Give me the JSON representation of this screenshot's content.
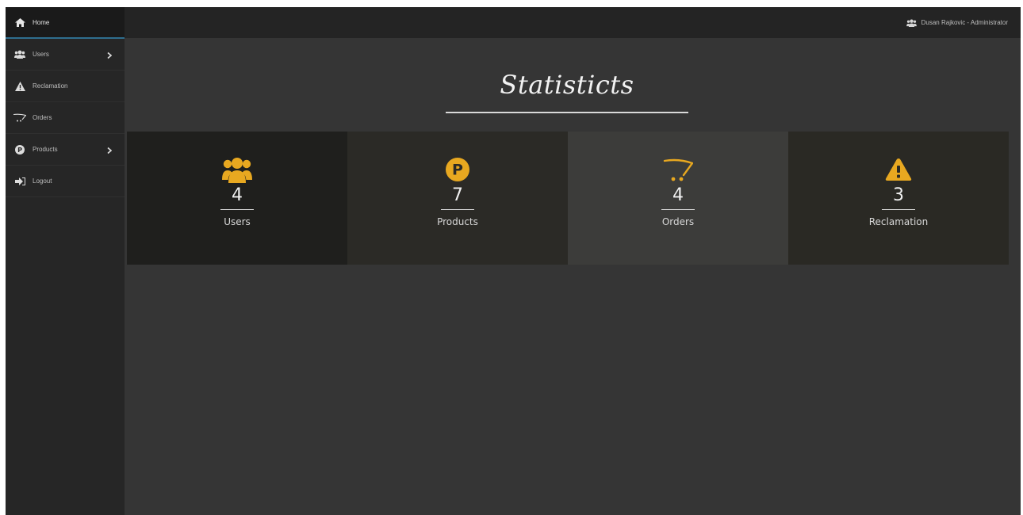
{
  "colors": {
    "accent": "#E8A820"
  },
  "sidebar": {
    "items": [
      {
        "label": "Home",
        "icon": "home-icon",
        "active": true
      },
      {
        "label": "Users",
        "icon": "users-icon",
        "has_children": true
      },
      {
        "label": "Reclamation",
        "icon": "warning-icon"
      },
      {
        "label": "Orders",
        "icon": "cart-icon"
      },
      {
        "label": "Products",
        "icon": "product-p-icon",
        "has_children": true
      },
      {
        "label": "Logout",
        "icon": "logout-icon"
      }
    ]
  },
  "header": {
    "user": "Dusan Rajkovic - Administrator",
    "user_icon": "users-icon"
  },
  "main": {
    "title": "Statisticts",
    "stats": [
      {
        "value": "4",
        "label": "Users",
        "icon": "users-icon",
        "bg": "#1f1f1d"
      },
      {
        "value": "7",
        "label": "Products",
        "icon": "product-p-icon",
        "bg": "#2b2a26"
      },
      {
        "value": "4",
        "label": "Orders",
        "icon": "cart-icon",
        "bg": "#3c3c3a"
      },
      {
        "value": "3",
        "label": "Reclamation",
        "icon": "warning-icon",
        "bg": "#2a2924"
      }
    ]
  }
}
